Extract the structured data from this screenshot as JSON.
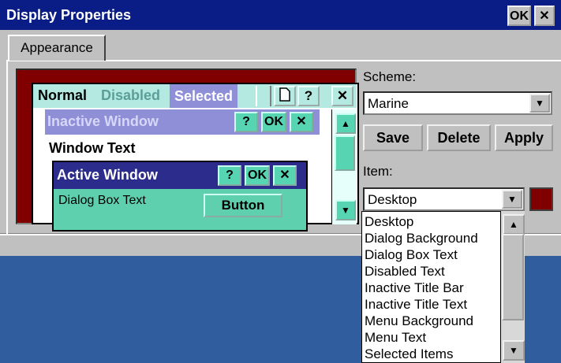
{
  "window": {
    "title": "Display Properties",
    "ok_label": "OK",
    "close_label": "✕"
  },
  "tab": {
    "label": "Appearance"
  },
  "preview": {
    "menu": [
      "Normal",
      "Disabled",
      "Selected"
    ],
    "menu_buttons": [
      "?",
      "✕"
    ],
    "inactive_title": "Inactive Window",
    "window_text": "Window Text",
    "active_title": "Active Window",
    "dialog_text": "Dialog Box Text",
    "button_label": "Button",
    "caption_buttons": [
      "?",
      "OK",
      "✕"
    ]
  },
  "scheme": {
    "label": "Scheme:",
    "value": "Marine"
  },
  "buttons": {
    "save": "Save",
    "delete": "Delete",
    "apply": "Apply"
  },
  "item": {
    "label": "Item:",
    "value": "Desktop",
    "color": "#800000"
  },
  "item_list": [
    "Desktop",
    "Dialog Background",
    "Dialog Box Text",
    "Disabled Text",
    "Inactive Title Bar",
    "Inactive Title Text",
    "Menu Background",
    "Menu Text",
    "Selected Items"
  ],
  "colors": {
    "title_bar": "#0a1d86",
    "desktop": "#2f5d9e",
    "menu_bg": "#b3e9e0",
    "dialog_bg": "#5fd0ad",
    "active_title": "#2c2c8c",
    "inactive_title": "#8f8fd8"
  }
}
